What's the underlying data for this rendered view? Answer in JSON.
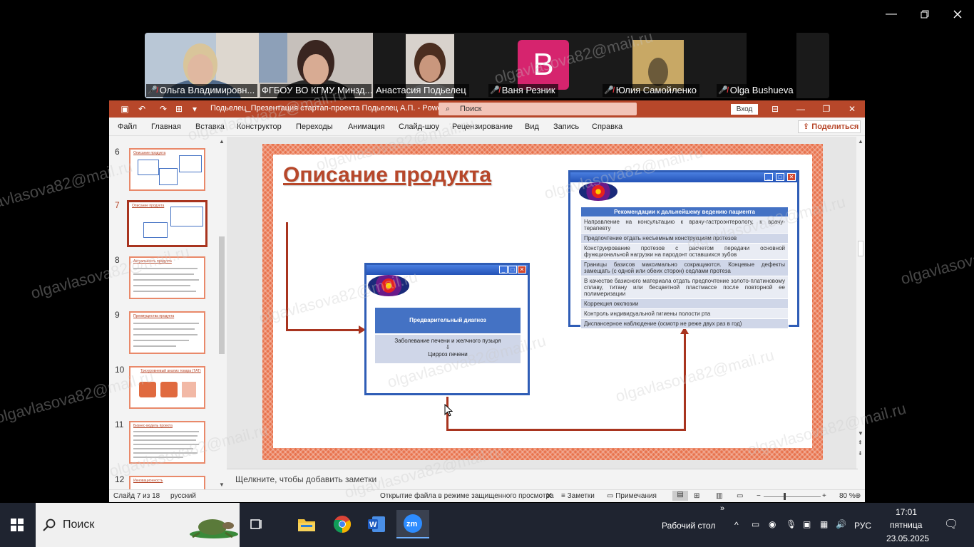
{
  "gallery": {
    "participants": [
      {
        "name": "Ольга Владимировн...",
        "muted": true,
        "bg": "#b9c7d6",
        "skin": "#e0b8a0",
        "hair": "#d9c59a"
      },
      {
        "name": "ФГБОУ ВО КГМУ Минзд...",
        "muted": false,
        "bg": "#c6c0bb",
        "skin": "#d8ab93",
        "hair": "#3a2520"
      },
      {
        "name": "Анастасия Подьелец",
        "muted": false,
        "active": true,
        "bg": "#d8d2cc",
        "skin": "#c9977d",
        "hair": "#4b2e20"
      },
      {
        "name": "Ваня Резник",
        "muted": true,
        "avatar_letter": "B",
        "avatar_color": "#d6246e"
      },
      {
        "name": "Юлия Самойленко",
        "muted": true,
        "bg": "#c8a865"
      },
      {
        "name": "Olga Bushueva",
        "muted": true
      }
    ]
  },
  "ppt": {
    "title": "Подьелец_Презентация стартап-проекта Подьелец А.П.  -  PowerPoint",
    "search_placeholder": "Поиск",
    "login": "Вход",
    "share": "Поделиться",
    "menu": [
      "Файл",
      "Главная",
      "Вставка",
      "Конструктор",
      "Переходы",
      "Анимация",
      "Слайд-шоу",
      "Рецензирование",
      "Вид",
      "Запись",
      "Справка"
    ],
    "thumbnails": [
      {
        "num": "6",
        "title": "Описание продукта"
      },
      {
        "num": "7",
        "title": "Описание продукта",
        "selected": true
      },
      {
        "num": "8",
        "title": "Актуальность продукта"
      },
      {
        "num": "9",
        "title": "Преимущества продукта"
      },
      {
        "num": "10",
        "title": "Трехуровневый анализ товара (ТАТ)"
      },
      {
        "num": "11",
        "title": "Бизнес-модель проекта"
      },
      {
        "num": "12",
        "title": "Инновационность"
      }
    ],
    "slide": {
      "title": "Описание продукта",
      "diagnosis_header": "Предварительный диагноз",
      "diagnosis_line1": "Заболевание печени и желчного пузыря",
      "diagnosis_arrow": "⇩",
      "diagnosis_line2": "Цирроз печени",
      "rec_header": "Рекомендации к дальнейшему ведению пациента",
      "recommendations": [
        "Направление на консультацию к врачу-гастроэнтерологу, к врачу-терапевту",
        "Предпочтение отдать несъемным конструкциям протезов",
        "Конструирование протезов с расчетом передачи основной функциональной нагрузки на пародонт оставшихся зубов",
        "Границы базисов максимально сокращаются. Концевые дефекты замещать (с одной или обеих сторон) седлами протеза",
        "В качестве базисного материала отдать предпочтение золото-платиновому сплаву, титану или бесцветной пластмассе после повторной ее полимеризации",
        "Коррекция окклюзии",
        "Контроль индивидуальной гигиены полости рта",
        "Диспансерное наблюдение (осмотр не реже двух раз в год)"
      ]
    },
    "notes_placeholder": "Щелкните, чтобы добавить заметки",
    "status": {
      "slide_counter": "Слайд 7 из 18",
      "language": "русский",
      "protected_msg": "Открытие файла в режиме защищенного просмотра",
      "notes": "Заметки",
      "comments": "Примечания",
      "zoom": "80 %"
    }
  },
  "watermark": "olgavlasova82@mail.ru",
  "taskbar": {
    "search": "Поиск",
    "desktop_label": "Рабочий стол",
    "lang": "РУС",
    "time": "17:01",
    "weekday": "пятница",
    "date": "23.05.2025"
  }
}
